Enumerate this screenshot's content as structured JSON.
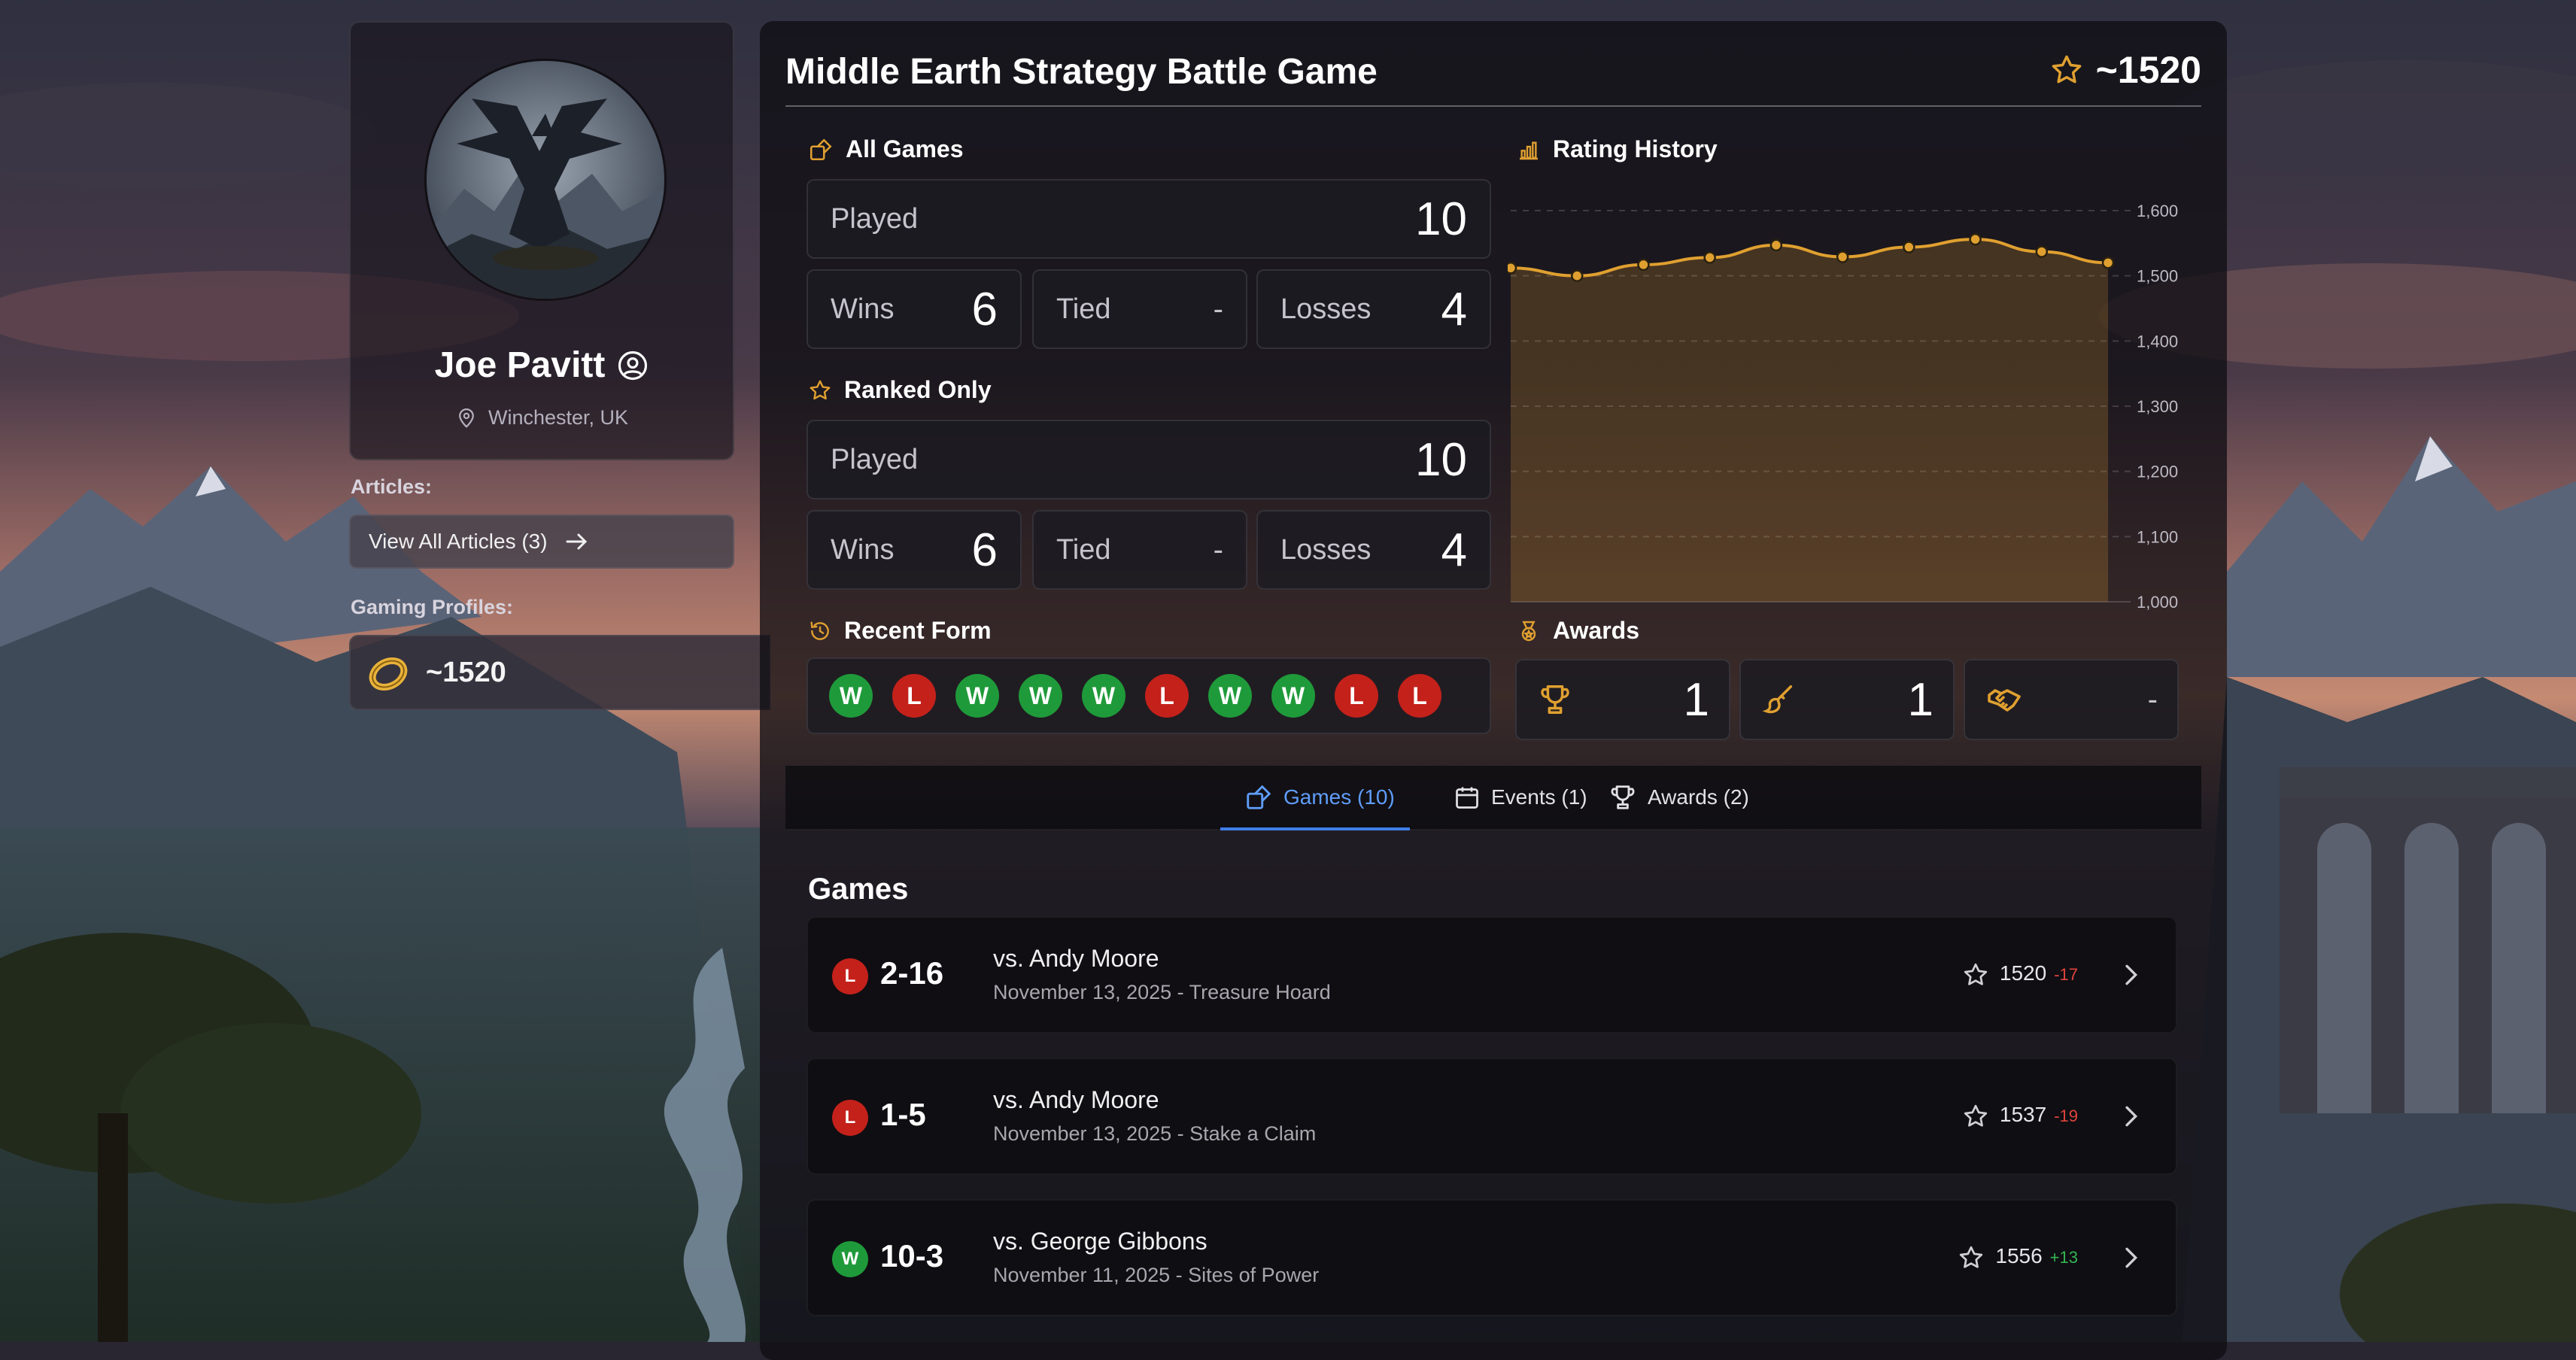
{
  "colors": {
    "accent": "#e0a030",
    "win": "#1f9a3a",
    "loss": "#c4211b",
    "tab_active": "#5f9dfa"
  },
  "profile": {
    "name": "Joe Pavitt",
    "location": "Winchester, UK",
    "articles_label": "Articles:",
    "articles_button": "View All Articles (3)",
    "gaming_profiles_label": "Gaming Profiles:",
    "gaming_profile_rating": "~1520",
    "icons": [
      "user-circle-icon",
      "map-pin-icon",
      "arrow-right-icon",
      "one-ring-icon"
    ]
  },
  "header": {
    "title": "Middle Earth Strategy Battle Game",
    "rating": "~1520",
    "icon": "star-icon"
  },
  "all_games": {
    "heading": "All Games",
    "played_label": "Played",
    "played": "10",
    "wins_label": "Wins",
    "wins": "6",
    "tied_label": "Tied",
    "tied": "-",
    "losses_label": "Losses",
    "losses": "4"
  },
  "ranked_only": {
    "heading": "Ranked Only",
    "played_label": "Played",
    "played": "10",
    "wins_label": "Wins",
    "wins": "6",
    "tied_label": "Tied",
    "tied": "-",
    "losses_label": "Losses",
    "losses": "4"
  },
  "recent_form": {
    "heading": "Recent Form",
    "results": [
      "W",
      "L",
      "W",
      "W",
      "W",
      "L",
      "W",
      "W",
      "L",
      "L"
    ]
  },
  "rating_history": {
    "heading": "Rating History"
  },
  "chart_data": {
    "type": "area",
    "title": "Rating History",
    "x": [
      1,
      2,
      3,
      4,
      5,
      6,
      7,
      8,
      9,
      10
    ],
    "values": [
      1512,
      1500,
      1517,
      1528,
      1547,
      1529,
      1544,
      1556,
      1537,
      1520
    ],
    "ylim": [
      1000,
      1600
    ],
    "yticks": [
      "1,000",
      "1,100",
      "1,200",
      "1,300",
      "1,400",
      "1,500",
      "1,600"
    ],
    "ytick_values": [
      1000,
      1100,
      1200,
      1300,
      1400,
      1500,
      1600
    ],
    "grid": true,
    "color": "#e0a030"
  },
  "awards": {
    "heading": "Awards",
    "items": [
      {
        "icon": "trophy-icon",
        "value": "1"
      },
      {
        "icon": "paintbrush-icon",
        "value": "1"
      },
      {
        "icon": "handshake-icon",
        "value": "-"
      }
    ]
  },
  "tabs": [
    {
      "label": "Games (10)",
      "icon": "games-icon",
      "active": true
    },
    {
      "label": "Events (1)",
      "icon": "calendar-icon",
      "active": false
    },
    {
      "label": "Awards (2)",
      "icon": "trophy-icon",
      "active": false
    }
  ],
  "games": {
    "heading": "Games",
    "rows": [
      {
        "result": "L",
        "score": "2-16",
        "opponent": "vs. Andy Moore",
        "meta": "November 13, 2025 - Treasure Hoard",
        "rating": "1520",
        "delta": "-17",
        "delta_sign": "neg"
      },
      {
        "result": "L",
        "score": "1-5",
        "opponent": "vs. Andy Moore",
        "meta": "November 13, 2025 - Stake a Claim",
        "rating": "1537",
        "delta": "-19",
        "delta_sign": "neg"
      },
      {
        "result": "W",
        "score": "10-3",
        "opponent": "vs. George Gibbons",
        "meta": "November 11, 2025 - Sites of Power",
        "rating": "1556",
        "delta": "+13",
        "delta_sign": "pos"
      }
    ]
  }
}
